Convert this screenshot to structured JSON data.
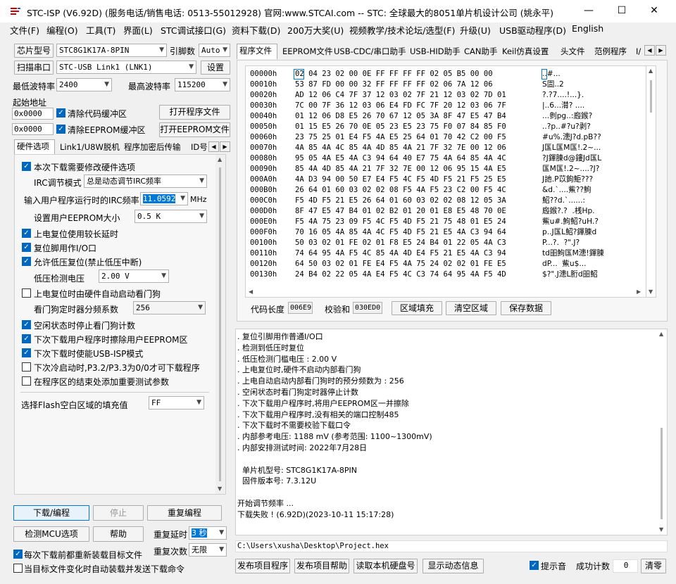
{
  "window": {
    "title": "STC-ISP (V6.92D) (服务电话/销售电话: 0513-55012928) 官网:www.STCAI.com  -- STC: 全球最大的8051单片机设计公司 (姚永平)",
    "minimize": "—",
    "maximize": "☐",
    "close": "✕"
  },
  "menu": [
    "文件(F)",
    "编程(O)",
    "工具(T)",
    "界面(L)",
    "STC调试接口(G)",
    "资料下载(D)",
    "200万大奖(U)",
    "视频教学/技术论坛/选型(F)",
    "升级(U)",
    "USB驱动程序(D)",
    "English"
  ],
  "left": {
    "chip_type_btn": "芯片型号",
    "chip_type": "STC8G1K17A-8PIN",
    "pins_label": "引脚数",
    "pins": "Auto",
    "scan_port_btn": "扫描串口",
    "port": "STC-USB Link1 (LNK1)",
    "settings_btn": "设置",
    "min_baud_label": "最低波特率",
    "min_baud": "2400",
    "max_baud_label": "最高波特率",
    "max_baud": "115200",
    "start_addr_label": "起始地址",
    "code_addr": "0x0000",
    "clear_code_label": "清除代码缓冲区",
    "open_prog_btn": "打开程序文件",
    "eeprom_addr": "0x0000",
    "clear_eeprom_label": "清除EEPROM缓冲区",
    "open_eeprom_btn": "打开EEPROM文件",
    "tabs": [
      "硬件选项",
      "Link1/U8W脱机",
      "程序加密后传输",
      "ID号"
    ],
    "hw": {
      "opt_modify": "本次下载需要修改硬件选项",
      "irc_mode_label": "IRC调节模式",
      "irc_mode": "总是动态调节IRC频率",
      "irc_freq_label": "输入用户程序运行时的IRC频率",
      "irc_freq": "11.0592",
      "irc_unit": "MHz",
      "eeprom_size_label": "设置用户EEPROM大小",
      "eeprom_size": "0.5 K",
      "opt_long_delay": "上电复位使用较长延时",
      "opt_reset_io": "复位脚用作I/O口",
      "opt_lvr": "允许低压复位(禁止低压中断)",
      "lvd_label": "低压检测电压",
      "lvd": "2.00 V",
      "opt_wdt_auto": "上电复位时由硬件自动启动看门狗",
      "wdt_div_label": "看门狗定时器分频系数",
      "wdt_div": "256",
      "opt_idle_wdt": "空闲状态时停止看门狗计数",
      "opt_erase_eeprom": "下次下载用户程序时擦除用户EEPROM区",
      "opt_usb_isp": "下次下载时使能USB-ISP模式",
      "opt_cold_boot": "下次冷启动时,P3.2/P3.3为0/0才可下载程序",
      "opt_test_params": "在程序区的结束处添加重要测试参数",
      "fill_label": "选择Flash空白区域的填充值",
      "fill_value": "FF"
    },
    "download_btn": "下载/编程",
    "stop_btn": "停止",
    "reprog_btn": "重复编程",
    "detect_btn": "检测MCU选项",
    "help_btn": "帮助",
    "repeat_delay_label": "重复延时",
    "repeat_delay": "3 秒",
    "repeat_count_label": "重复次数",
    "repeat_count": "无限",
    "reload_label": "每次下载前都重新装载目标文件",
    "auto_send_label": "当目标文件变化时自动装载并发送下载命令"
  },
  "right": {
    "tabs": [
      "程序文件",
      "EEPROM文件",
      "USB-CDC/串口助手",
      "USB-HID助手",
      "CAN助手",
      "Keil仿真设置",
      "头文件",
      "范例程序",
      "I/"
    ],
    "hex_rows": [
      {
        "addr": "00000h",
        "bytes": "02 04 23 02 00 0E FF FF FF FF 02 05 B5 00 00",
        "ascii": "..#..."
      },
      {
        "addr": "00010h",
        "bytes": "53 87 FD 00 00 32 FF FF FF FF 02 06 7A 12 06",
        "ascii": "S圁..2"
      },
      {
        "addr": "00020h",
        "bytes": "AD 12 06 C4 7F 37 12 03 02 7F 21 12 03 02 7D 01",
        "ascii": "?.?7....!...}."
      },
      {
        "addr": "00030h",
        "bytes": "7C 00 7F 36 12 03 06 E4 FD FC 7F 20 12 03 06 7F",
        "ascii": "|..6...潸? ...."
      },
      {
        "addr": "00040h",
        "bytes": "01 12 06 D8 E5 26 70 67 12 05 3A 8F 47 E5 47 B4",
        "ascii": "...剼pg..:廏鍭?"
      },
      {
        "addr": "00050h",
        "bytes": "01 15 E5 26 70 0E 05 23 E5 23 75 F0 07 84 85 F0",
        "ascii": "..?p..#?u?剥?"
      },
      {
        "addr": "00060h",
        "bytes": "23 75 25 01 E4 F5 4A E5 25 64 01 70 42 C2 00 F5",
        "ascii": "#u%.漶J?d.pB??"
      },
      {
        "addr": "00070h",
        "bytes": "4A 85 4A 4C 85 4A 4D 85 4A 21 7F 32 7E 00 12 06",
        "ascii": "J匤L匤M匤!.2~..."
      },
      {
        "addr": "00080h",
        "bytes": "95 05 4A E5 4A C3 94 64 40 E7 75 4A 64 85 4A 4C",
        "ascii": "?J鍕腖d@鏤Jd匤L"
      },
      {
        "addr": "00090h",
        "bytes": "85 4A 4D 85 4A 21 7F 32 7E 00 12 06 95 15 4A E5",
        "ascii": "匤M匤!.2~....?J?"
      },
      {
        "addr": "000A0h",
        "bytes": "4A D3 94 00 50 E7 E4 F5 4C F5 4D F5 21 F5 25 E5",
        "ascii": "J訑.P苡鉤鮔???"
      },
      {
        "addr": "000B0h",
        "bytes": "26 64 01 60 03 02 02 08 F5 4A F5 23 C2 00 F5 4C",
        "ascii": "&d.`....鮆??鮈"
      },
      {
        "addr": "000C0h",
        "bytes": "F5 4D F5 21 E5 26 64 01 60 03 02 02 08 12 05 3A",
        "ascii": "鮉??d.`......:"
      },
      {
        "addr": "000D0h",
        "bytes": "8F 47 E5 47 B4 01 02 B2 01 20 01 E8 E5 48 70 0E",
        "ascii": "廏鍭?.?  .桟Hp."
      },
      {
        "addr": "000E0h",
        "bytes": "F5 4A 75 23 09 F5 4C F5 4D F5 21 75 48 01 E5 24",
        "ascii": "鮆u#.鮈鮉?uH.?"
      },
      {
        "addr": "000F0h",
        "bytes": "70 16 05 4A 85 4A 4C F5 4D F5 21 E5 4A C3 94 64",
        "ascii": "p..J匤L鮉?鍕腖d"
      },
      {
        "addr": "00100h",
        "bytes": "50 03 02 01 FE 02 01 F8 E5 24 B4 01 22 05 4A C3",
        "ascii": "P...?.  ?\".J?"
      },
      {
        "addr": "00110h",
        "bytes": "74 64 95 4A F5 4C 85 4A 4D E4 F5 21 E5 4A C3 94",
        "ascii": "td昍鮈匤M漶!鍕腖"
      },
      {
        "addr": "00120h",
        "bytes": "64 50 03 02 01 FE E4 F5 4A 75 24 02 02 01 FE E5",
        "ascii": "dP...  鮆u$..."
      },
      {
        "addr": "00130h",
        "bytes": "24 B4 02 22 05 4A E4 F5 4C C3 74 64 95 4A F5 4D",
        "ascii": "$?\".J漶L胻d昍鮉"
      }
    ],
    "code_len_label": "代码长度",
    "code_len": "006E9",
    "checksum_label": "校验和",
    "checksum": "030ED0",
    "fill_btn": "区域填充",
    "clear_btn": "清空区域",
    "save_btn": "保存数据",
    "log_lines": [
      ". 复位引脚用作普通I/O口",
      ". 检测到低压时复位",
      ". 低压检测门槛电压 : 2.00 V",
      ". 上电复位时,硬件不启动内部看门狗",
      ". 上电自动启动内部看门狗时的预分频数为 : 256",
      ". 空闲状态时看门狗定时器停止计数",
      ". 下次下载用户程序时,将用户EEPROM区一并擦除",
      ". 下次下载用户程序时,没有相关的端口控制485",
      ". 下次下载时不需要校验下载口令",
      ". 内部参考电压: 1188 mV (参考范围: 1100~1300mV)",
      ". 内部安排测试时间: 2022年7月28日",
      "",
      "  单片机型号: STC8G1K17A-8PIN",
      "  固件版本号: 7.3.12U",
      "",
      "开始调节频率 ...",
      "下载失败 ! (6.92D)(2023-10-11 15:17:28)"
    ],
    "file_path": "C:\\Users\\xusha\\Desktop\\Project.hex",
    "publish_prog_btn": "发布项目程序",
    "publish_help_btn": "发布项目帮助",
    "read_disk_btn": "读取本机硬盘号",
    "show_dyn_btn": "显示动态信息",
    "beep_label": "提示音",
    "success_label": "成功计数",
    "success_count": "0",
    "clear_count_btn": "清零"
  }
}
